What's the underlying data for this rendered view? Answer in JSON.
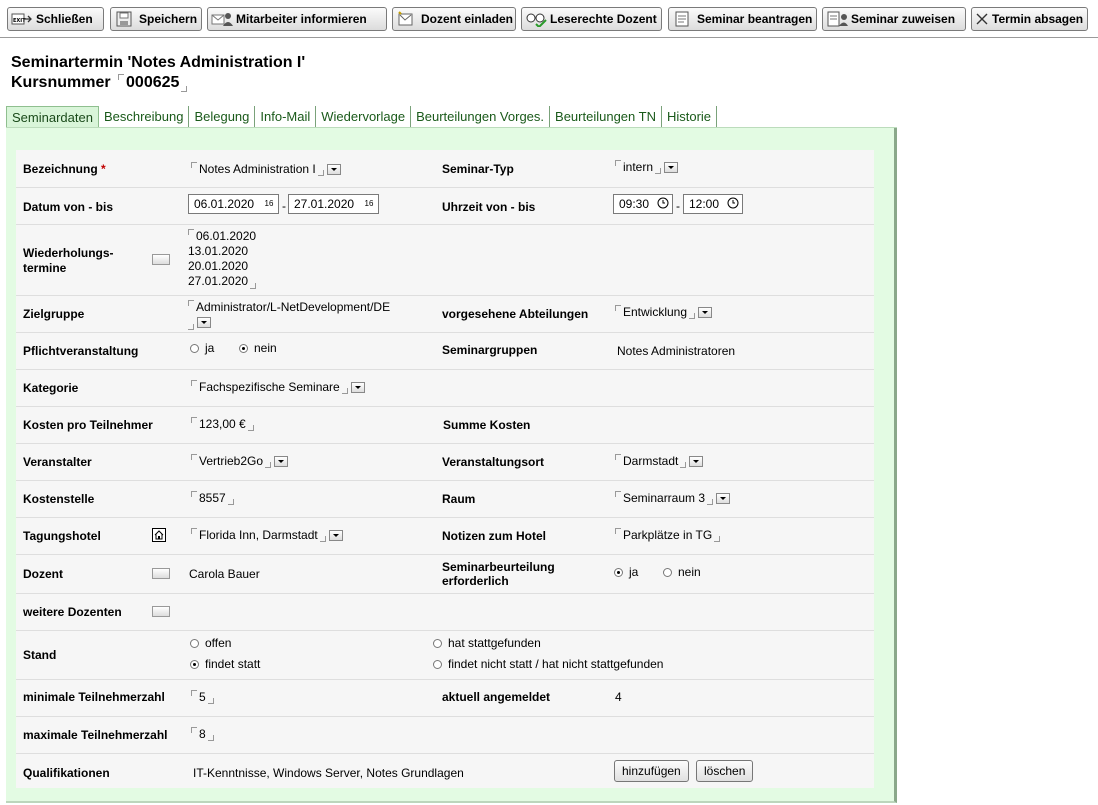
{
  "toolbar": {
    "close": "Schließen",
    "save": "Speichern",
    "inform": "Mitarbeiter informieren",
    "invite": "Dozent einladen",
    "readrights": "Leserechte Dozent",
    "request": "Seminar beantragen",
    "assign": "Seminar zuweisen",
    "cancel": "Termin absagen"
  },
  "header": {
    "line1": "Seminartermin 'Notes Administration I'",
    "course_label": "Kursnummer",
    "course_number": "000625"
  },
  "tabs": [
    "Seminardaten",
    "Beschreibung",
    "Belegung",
    "Info-Mail",
    "Wiedervorlage",
    "Beurteilungen Vorges.",
    "Beurteilungen TN",
    "Historie"
  ],
  "form": {
    "bezeichnung": {
      "label": "Bezeichnung",
      "required": "*",
      "value": "Notes Administration I"
    },
    "seminartyp": {
      "label": "Seminar-Typ",
      "value": "intern"
    },
    "datum": {
      "label": "Datum von - bis",
      "from": "06.01.2020",
      "to": "27.01.2020",
      "sep": "-"
    },
    "uhrzeit": {
      "label": "Uhrzeit von - bis",
      "from": "09:30",
      "to": "12:00",
      "sep": "-"
    },
    "wiederholung": {
      "label_1": "Wiederholungs-",
      "label_2": "termine",
      "dates": [
        "06.01.2020",
        "13.01.2020",
        "20.01.2020",
        "27.01.2020"
      ]
    },
    "zielgruppe": {
      "label": "Zielgruppe",
      "value": "Administrator/L-NetDevelopment/DE"
    },
    "abteilungen": {
      "label": "vorgesehene Abteilungen",
      "value": "Entwicklung"
    },
    "pflicht": {
      "label": "Pflichtveranstaltung",
      "yes": "ja",
      "no": "nein",
      "selected": "nein"
    },
    "seminargruppen": {
      "label": "Seminargruppen",
      "value": "Notes Administratoren"
    },
    "kategorie": {
      "label": "Kategorie",
      "value": "Fachspezifische Seminare"
    },
    "kosten": {
      "label": "Kosten pro Teilnehmer",
      "value": "123,00 €"
    },
    "summe": {
      "label": "Summe Kosten",
      "value": ""
    },
    "veranstalter": {
      "label": "Veranstalter",
      "value": "Vertrieb2Go"
    },
    "ort": {
      "label": "Veranstaltungsort",
      "value": "Darmstadt"
    },
    "kostenstelle": {
      "label": "Kostenstelle",
      "value": "8557"
    },
    "raum": {
      "label": "Raum",
      "value": "Seminarraum 3"
    },
    "hotel": {
      "label": "Tagungshotel",
      "value": "Florida Inn, Darmstadt"
    },
    "notizen": {
      "label": "Notizen zum Hotel",
      "value": "Parkplätze in TG"
    },
    "dozent": {
      "label": "Dozent",
      "value": "Carola Bauer"
    },
    "beurteilung": {
      "label_1": "Seminarbeurteilung",
      "label_2": "erforderlich",
      "yes": "ja",
      "no": "nein",
      "selected": "ja"
    },
    "weitere": {
      "label": "weitere Dozenten"
    },
    "stand": {
      "label": "Stand",
      "opt1": "offen",
      "opt2": "findet statt",
      "opt3": "hat stattgefunden",
      "opt4": "findet nicht statt / hat nicht stattgefunden",
      "selected": "findet statt"
    },
    "min": {
      "label": "minimale Teilnehmerzahl",
      "value": "5"
    },
    "angemeldet": {
      "label": "aktuell angemeldet",
      "value": "4"
    },
    "max": {
      "label": "maximale Teilnehmerzahl",
      "value": "8"
    },
    "qualifikationen": {
      "label": "Qualifikationen",
      "value": "IT-Kenntnisse, Windows Server, Notes Grundlagen",
      "add": "hinzufügen",
      "delete": "löschen"
    }
  }
}
